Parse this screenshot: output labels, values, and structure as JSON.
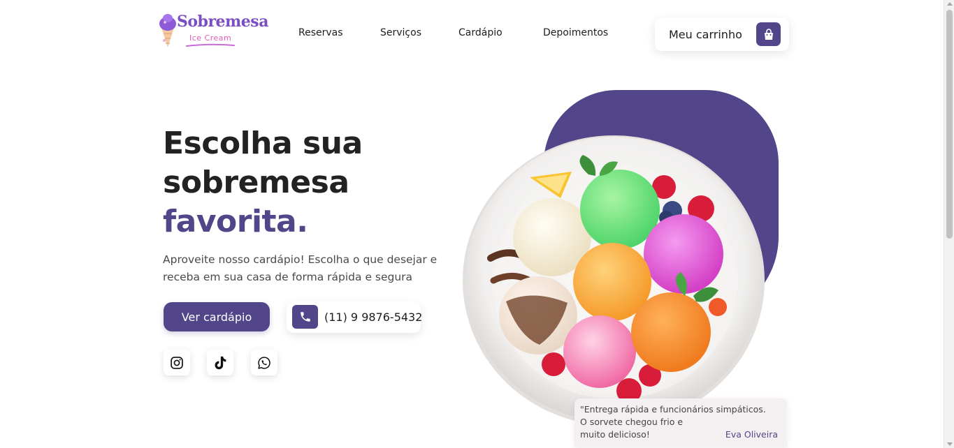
{
  "brand": {
    "name": "Sobremesa",
    "tagline": "Ice Cream",
    "primary_color": "#52458a",
    "logo_color": "#7b4fc4",
    "logo_accent_color": "#e05bb9"
  },
  "nav": {
    "items": [
      {
        "label": "Reservas"
      },
      {
        "label": "Serviços"
      },
      {
        "label": "Cardápio"
      },
      {
        "label": "Depoimentos"
      }
    ]
  },
  "cart": {
    "label": "Meu carrinho",
    "icon": "shopping-bag-icon"
  },
  "hero": {
    "title_line1": "Escolha sua",
    "title_line2": "sobremesa",
    "title_accent": "favorita.",
    "description_line1": "Aproveite nosso cardápio! Escolha o que desejar e",
    "description_line2": "receba em sua casa de forma rápida e segura",
    "cta_label": "Ver cardápio",
    "phone": "(11) 9 9876-5432",
    "phone_icon": "phone-icon"
  },
  "social": [
    {
      "name": "instagram",
      "icon": "instagram-icon"
    },
    {
      "name": "tiktok",
      "icon": "tiktok-icon"
    },
    {
      "name": "whatsapp",
      "icon": "whatsapp-icon"
    }
  ],
  "hero_image": {
    "icon": "ice-cream-plate-image"
  },
  "testimonial": {
    "line1": "\"Entrega rápida e funcionários simpáticos.",
    "line2": "O sorvete chegou frio e",
    "line3": "muito delicioso!",
    "author": "Eva Oliveira"
  }
}
